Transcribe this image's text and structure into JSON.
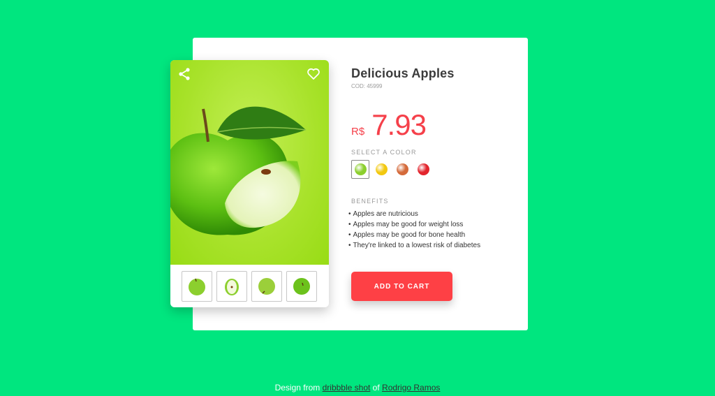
{
  "product": {
    "title": "Delicious Apples",
    "code": "COD: 45999",
    "currency": "R$",
    "price": "7.93",
    "select_color_label": "SELECT A COLOR",
    "colors": [
      {
        "name": "green",
        "hex": "#8ccf2e",
        "selected": true
      },
      {
        "name": "yellow",
        "hex": "#f2c80f",
        "selected": false
      },
      {
        "name": "gala",
        "hex": "#d46a3a",
        "selected": false
      },
      {
        "name": "red",
        "hex": "#e2242c",
        "selected": false
      }
    ],
    "benefits_label": "BENEFITS",
    "benefits": [
      "Apples are nutricious",
      "Apples may be good for weight loss",
      "Apples may be good for bone health",
      "They're linked to a lowest risk of diabetes"
    ],
    "add_to_cart_label": "ADD TO CART"
  },
  "gallery": {
    "icons": {
      "share": "share-icon",
      "favorite": "heart-icon"
    },
    "thumbnails": [
      "green-apple-whole",
      "green-apple-half",
      "green-apple-bottom",
      "green-apple-top"
    ]
  },
  "footer": {
    "prefix": "Design from ",
    "link1": "dribbble shot",
    "middle": " of ",
    "link2": "Rodrigo Ramos"
  },
  "colors": {
    "background": "#00e67f",
    "accent": "#fe4045"
  }
}
